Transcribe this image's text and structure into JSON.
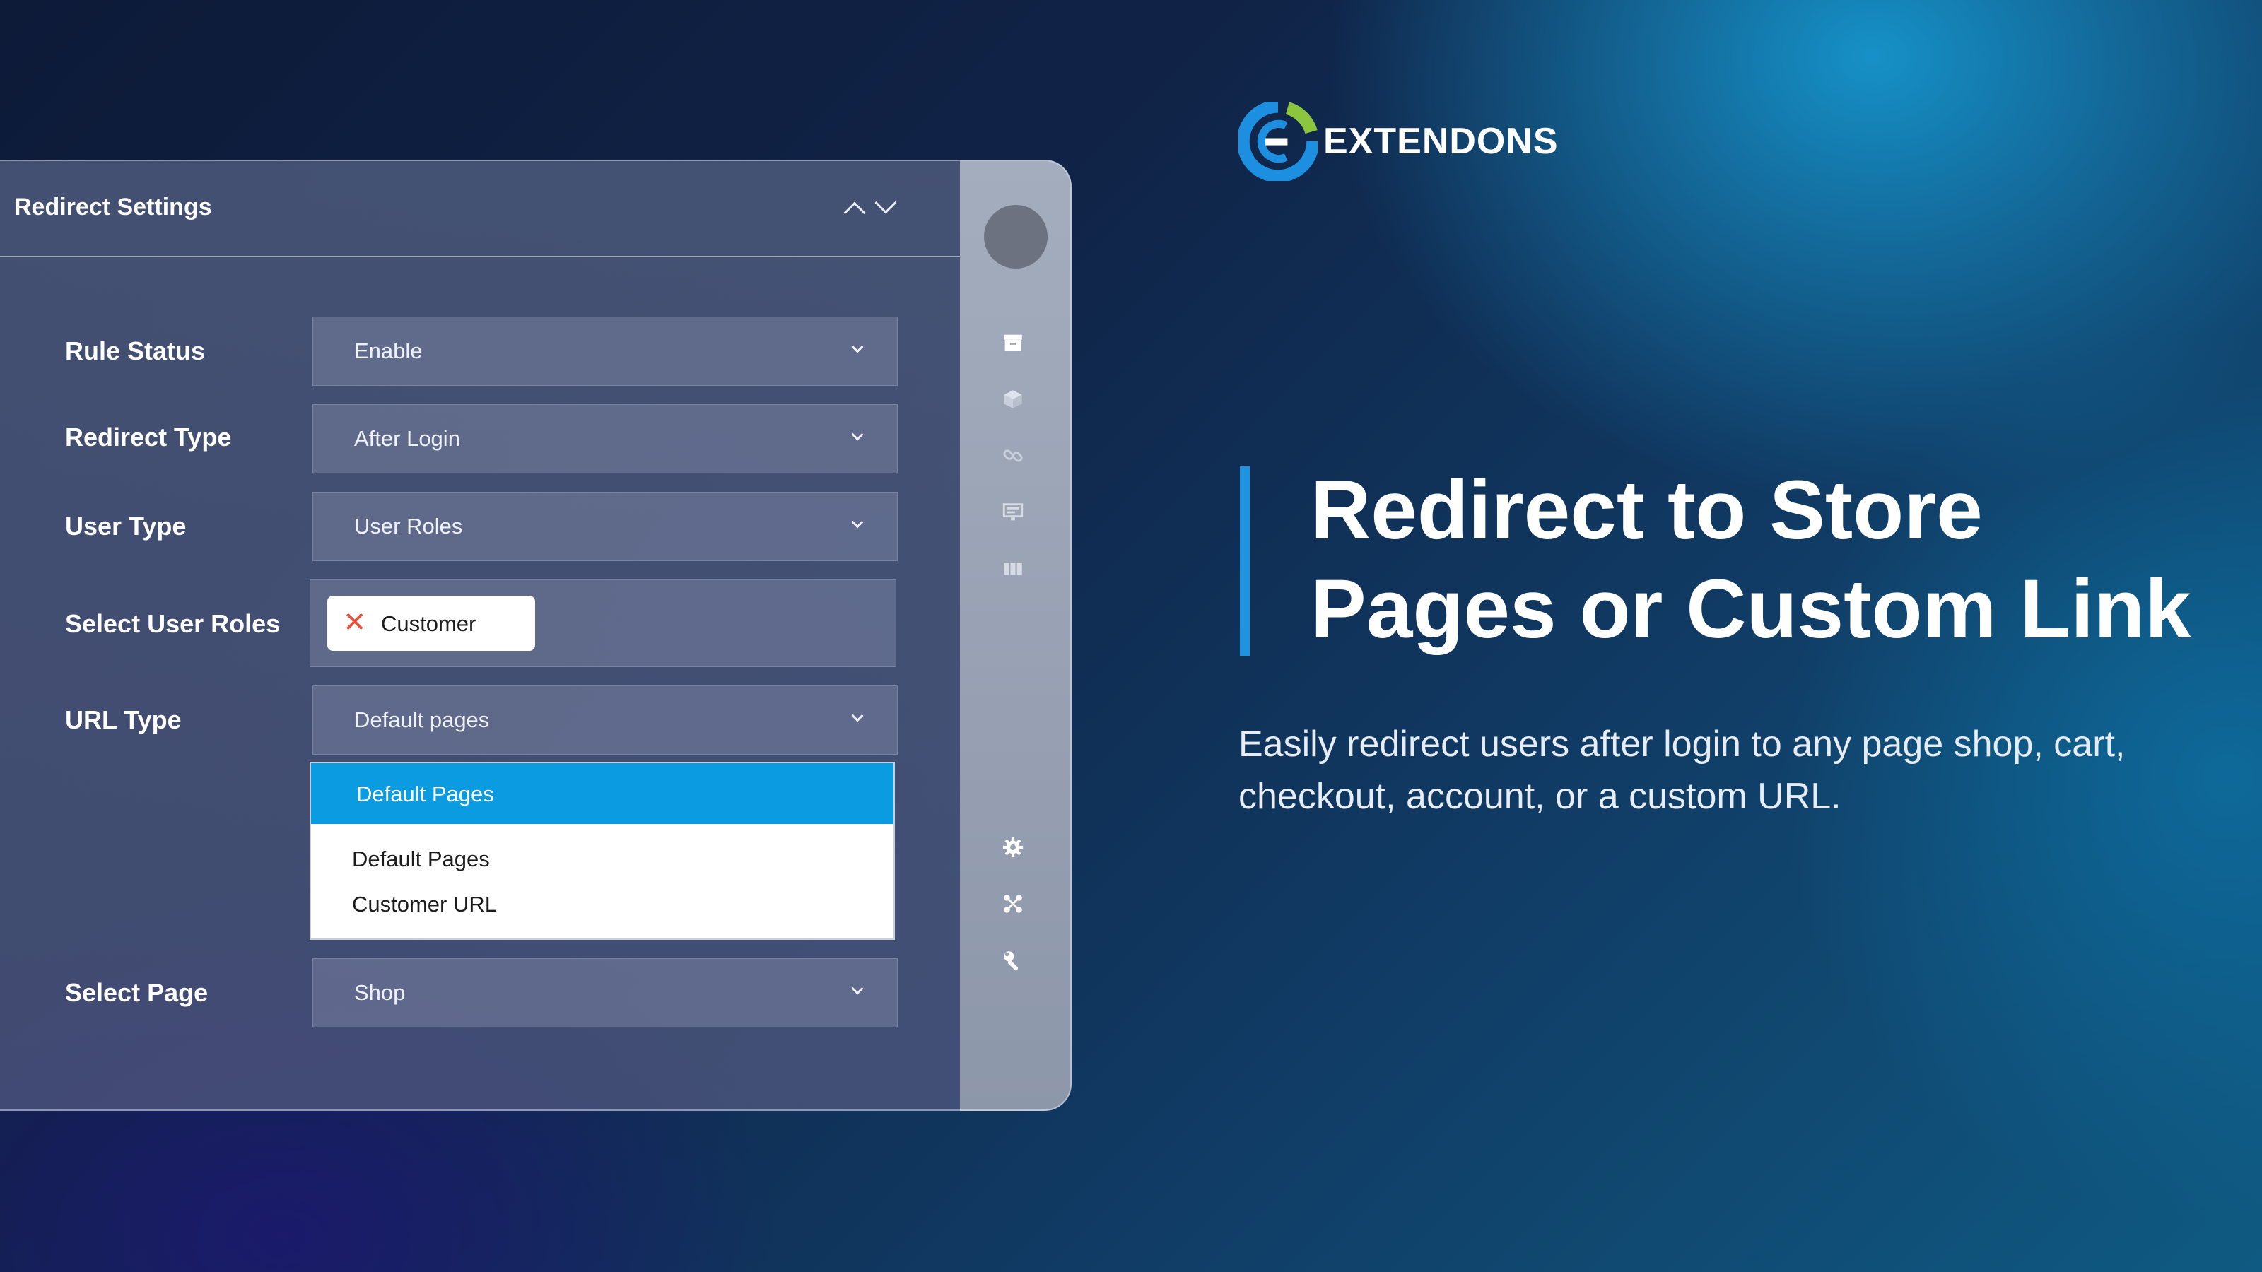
{
  "brand": {
    "name": "EXTENDONS"
  },
  "panel": {
    "title": "Redirect Settings",
    "rows": [
      {
        "label": "Rule Status",
        "value": "Enable"
      },
      {
        "label": "Redirect Type",
        "value": "After Login"
      },
      {
        "label": "User Type",
        "value": "User Roles"
      },
      {
        "label": "Select User Roles",
        "tag": "Customer"
      },
      {
        "label": "URL Type",
        "value": "Default pages"
      },
      {
        "label": "Select Page",
        "value": "Shop"
      }
    ],
    "dropdown": {
      "highlighted": "Default Pages",
      "options": [
        "Default Pages",
        "Customer URL"
      ]
    }
  },
  "rail": {
    "icons": [
      "archive-icon",
      "cube-icon",
      "link-icon",
      "monitor-icon",
      "columns-icon",
      "gear-icon",
      "network-icon",
      "wrench-icon"
    ]
  },
  "hero": {
    "headline": "Redirect to Store Pages or Custom Link",
    "subtext": "Easily redirect users after login to any page shop, cart, checkout, account, or a custom URL."
  },
  "colors": {
    "accent": "#1f93e0",
    "dropdown_highlight": "#0b9be0",
    "remove_x": "#e8543a",
    "logo_blue": "#1c8fe0",
    "logo_green": "#8cc63f"
  }
}
